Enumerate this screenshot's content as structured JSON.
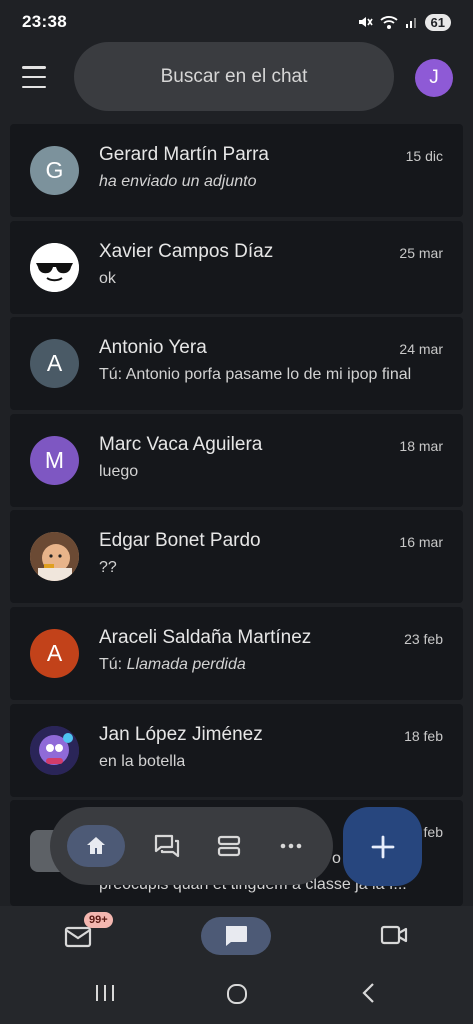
{
  "status": {
    "time": "23:38",
    "battery": "61"
  },
  "search": {
    "placeholder": "Buscar en el chat"
  },
  "account": {
    "initial": "J",
    "color": "#8e5ad6"
  },
  "chats": [
    {
      "avatar": "G",
      "avatar_color": "#7c929c",
      "name": "Gerard Martín Parra",
      "date": "15 dic",
      "snippet_prefix": "",
      "snippet": "ha enviado un adjunto",
      "italic": true
    },
    {
      "avatar": "",
      "avatar_color": "#ffffff",
      "avatar_icon": "sunglasses-avatar",
      "name": "Xavier Campos Díaz",
      "date": "25 mar",
      "snippet_prefix": "",
      "snippet": "ok",
      "italic": false
    },
    {
      "avatar": "A",
      "avatar_color": "#4a5a66",
      "name": "Antonio Yera",
      "date": "24 mar",
      "snippet_prefix": "Tú: ",
      "snippet": "Antonio porfa pasame lo de mi ipop final",
      "italic": false
    },
    {
      "avatar": "M",
      "avatar_color": "#7e57c2",
      "name": "Marc Vaca Aguilera",
      "date": "18 mar",
      "snippet_prefix": "",
      "snippet": "luego",
      "italic": false
    },
    {
      "avatar": "",
      "avatar_color": "#c9a27e",
      "avatar_icon": "baby-photo-avatar",
      "name": "Edgar Bonet Pardo",
      "date": "16 mar",
      "snippet_prefix": "",
      "snippet": "??",
      "italic": false
    },
    {
      "avatar": "A",
      "avatar_color": "#c2421a",
      "name": "Araceli Saldaña Martínez",
      "date": "23 feb",
      "snippet_prefix": "Tú: ",
      "snippet": "Llamada perdida",
      "italic": true
    },
    {
      "avatar": "",
      "avatar_color": "#3a2c6e",
      "avatar_icon": "game-character-avatar",
      "name": "Jan López Jiménez",
      "date": "18 feb",
      "snippet_prefix": "",
      "snippet": "en la botella",
      "italic": false
    }
  ],
  "partial_chat": {
    "date": "feb",
    "line1": "o",
    "snippet": "preocupis quan et tinguem a classe ja la f..."
  },
  "bottom_nav": {
    "mail_badge": "99+"
  },
  "colors": {
    "background": "#1f2125",
    "card": "#15171b",
    "accent": "#4d5a76",
    "fab": "#27467e"
  }
}
